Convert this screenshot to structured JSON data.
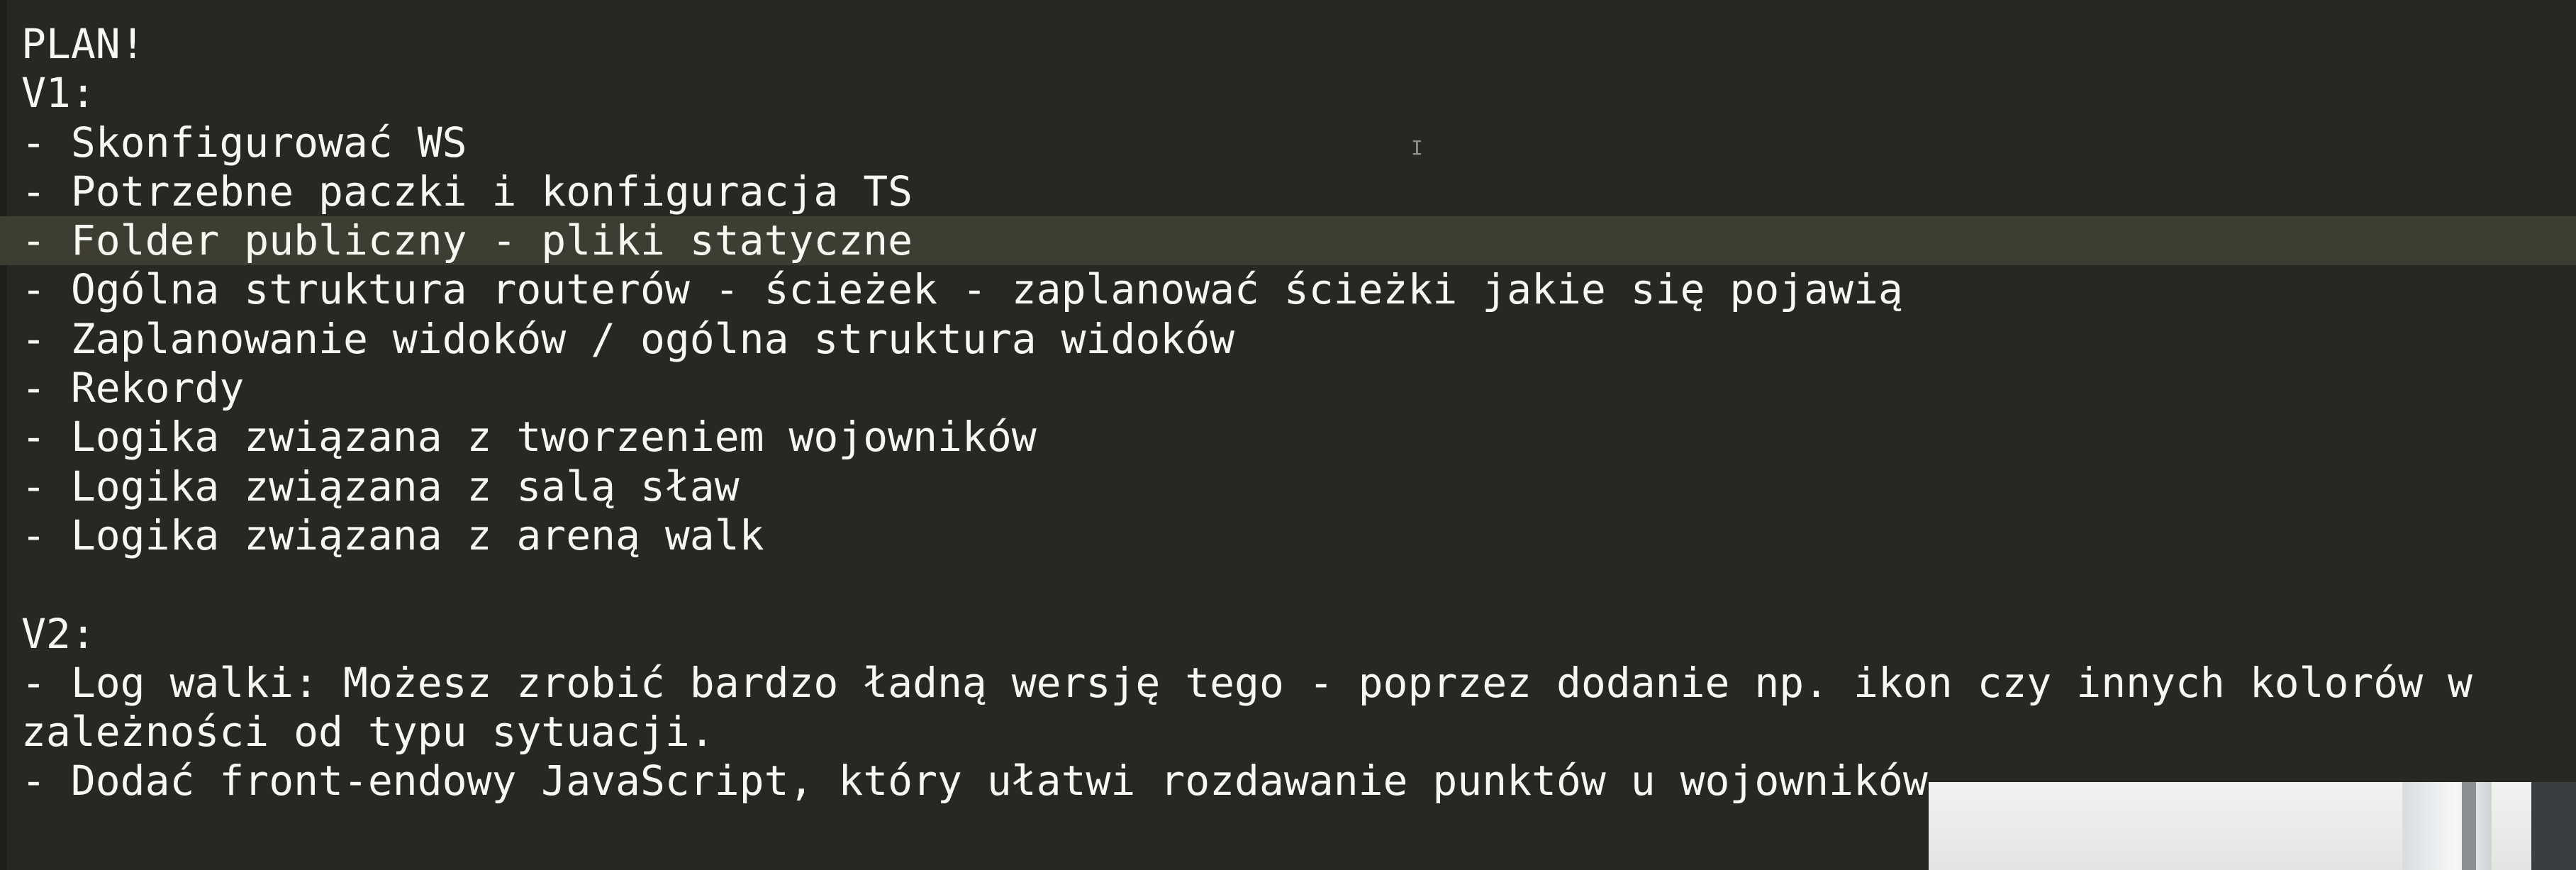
{
  "editor": {
    "lines": [
      "PLAN!",
      "V1:",
      "- Skonfigurować WS",
      "- Potrzebne paczki i konfiguracja TS",
      "- Folder publiczny - pliki statyczne",
      "- Ogólna struktura routerów - ścieżek - zaplanować ścieżki jakie się pojawią",
      "- Zaplanowanie widoków / ogólna struktura widoków",
      "- Rekordy",
      "- Logika związana z tworzeniem wojowników",
      "- Logika związana z salą sław",
      "- Logika związana z areną walk",
      "",
      "V2:",
      "- Log walki: Możesz zrobić bardzo ładną wersję tego - poprzez dodanie np. ikon czy innych kolorów w",
      "zależności od typu sytuacji.",
      "- Dodać front-endowy JavaScript, który ułatwi rozdawanie punktów u wojowników."
    ],
    "current_line_index": 4
  },
  "colors": {
    "background": "#272822",
    "text": "#f8f8f2",
    "current_line": "#3e3d32"
  }
}
